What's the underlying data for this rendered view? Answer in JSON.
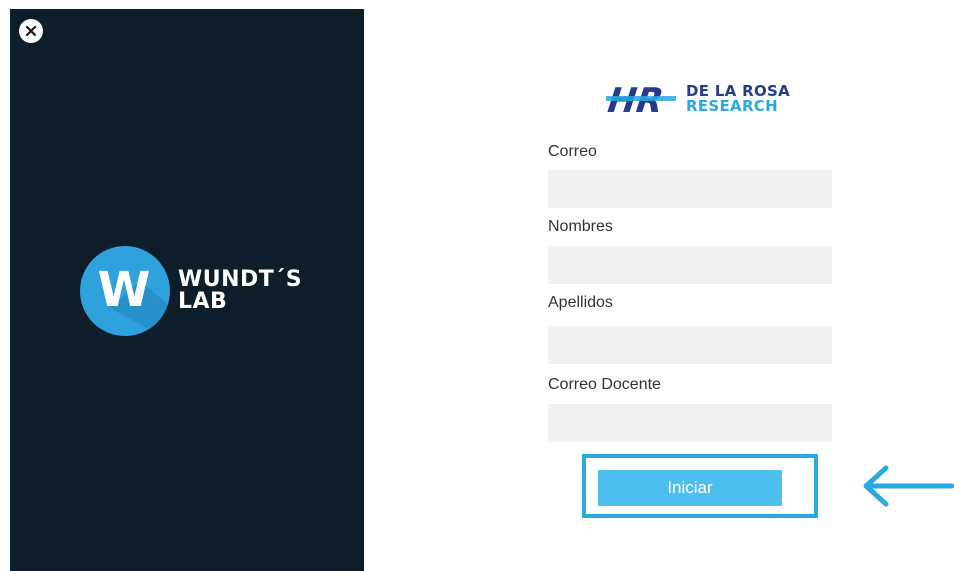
{
  "left_panel": {
    "close_icon": "close-icon",
    "logo": {
      "letter": "W",
      "name_line1": "WUNDT´S",
      "name_line2": "LAB"
    }
  },
  "brand": {
    "monogram": "HR",
    "name_line1": "DE LA ROSA",
    "name_line2": "RESEARCH"
  },
  "form": {
    "fields": [
      {
        "label": "Correo",
        "value": ""
      },
      {
        "label": "Nombres",
        "value": ""
      },
      {
        "label": "Apellidos",
        "value": ""
      },
      {
        "label": "Correo Docente",
        "value": ""
      }
    ],
    "submit_label": "Iniciar"
  },
  "annotation": {
    "arrow_icon": "arrow-left-icon"
  },
  "colors": {
    "panel_bg": "#0d1d2a",
    "accent": "#2aa8e0",
    "button": "#4dbfee",
    "brand_dark": "#243a8c",
    "input_bg": "#f0f0f0"
  }
}
